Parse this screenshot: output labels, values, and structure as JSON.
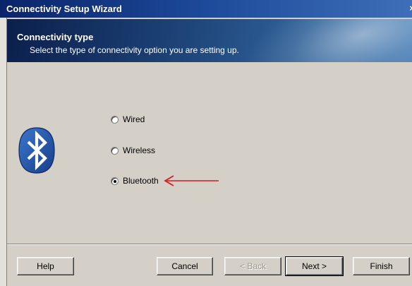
{
  "window": {
    "title": "Connectivity Setup Wizard",
    "close_label": "×"
  },
  "header": {
    "title": "Connectivity type",
    "subtitle": "Select the type of connectivity option you are setting up."
  },
  "options": [
    {
      "label": "Wired",
      "selected": false
    },
    {
      "label": "Wireless",
      "selected": false
    },
    {
      "label": "Bluetooth",
      "selected": true
    }
  ],
  "icons": {
    "logo": "bluetooth-icon",
    "pointer": "arrow-left-icon"
  },
  "buttons": {
    "help": "Help",
    "cancel": "Cancel",
    "back": "< Back",
    "next": "Next >",
    "finish": "Finish"
  },
  "colors": {
    "face": "#d4d0c8",
    "bluetooth_blue": "#1f54a8",
    "arrow_red": "#d21e1e"
  }
}
